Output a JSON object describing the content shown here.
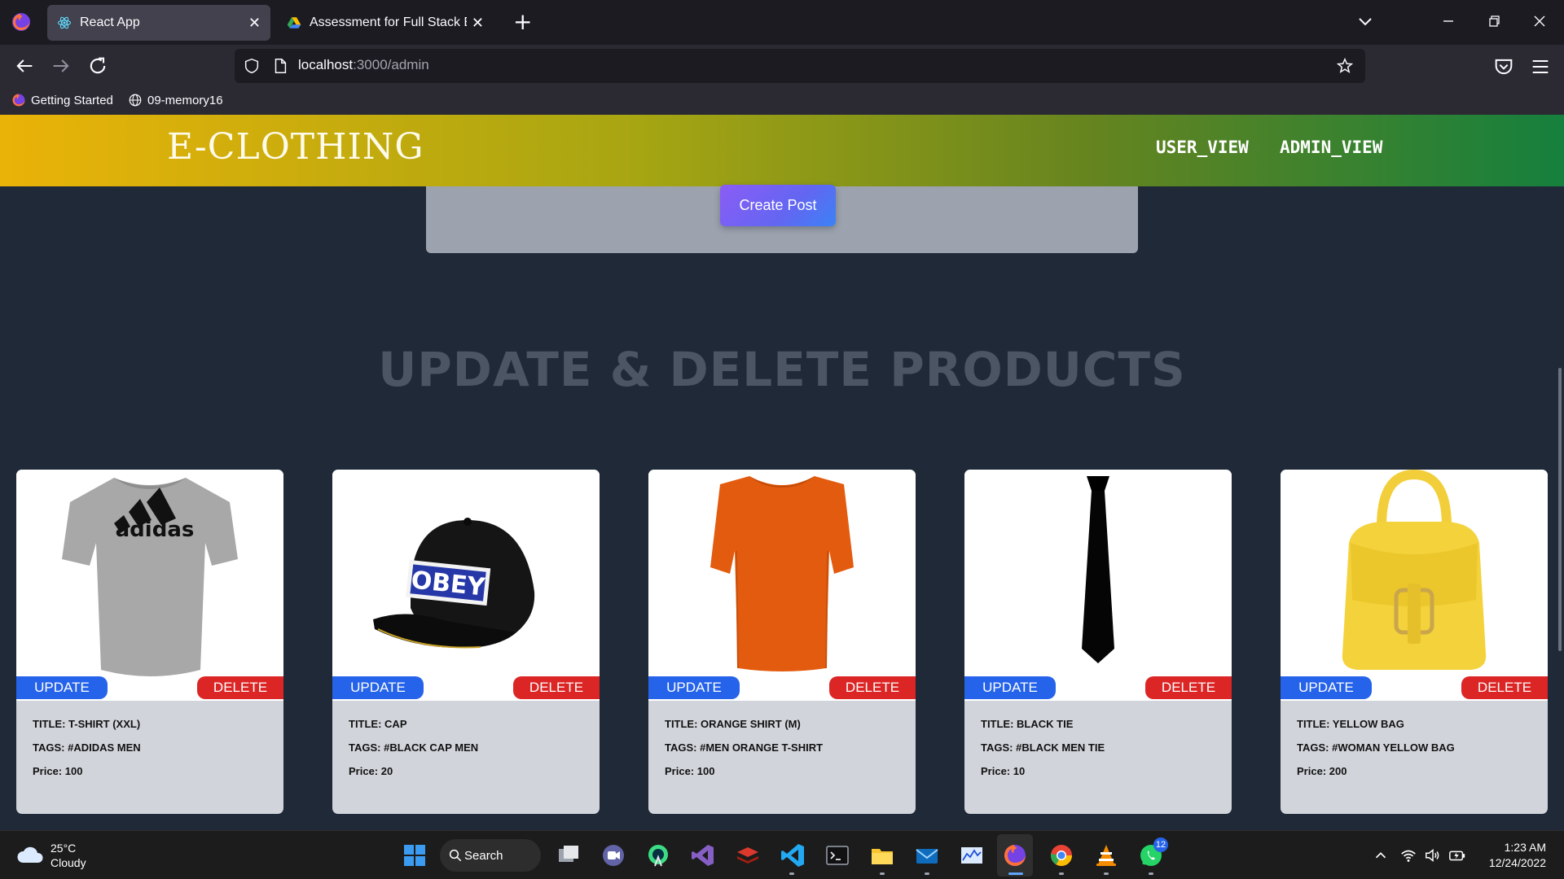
{
  "browser": {
    "tabs": [
      {
        "title": "React App",
        "active": true
      },
      {
        "title": "Assessment for Full Stack Engin",
        "active": false
      }
    ],
    "url_host": "localhost",
    "url_rest": ":3000/admin",
    "bookmarks": [
      "Getting Started",
      "09-memory16"
    ]
  },
  "header": {
    "brand": "E-CLOTHING",
    "nav": [
      "USER_VIEW",
      "ADMIN_VIEW"
    ]
  },
  "form": {
    "create_label": "Create Post"
  },
  "section": {
    "title": "UPDATE & DELETE PRODUCTS"
  },
  "card_actions": {
    "update": "UPDATE",
    "delete": "DELETE"
  },
  "products": [
    {
      "title": "TITLE: T-SHIRT (XXL)",
      "tags": "TAGS: #ADIDAS MEN",
      "price": "Price: 100",
      "image": "grey-adidas-tshirt",
      "logo_text": "adidas"
    },
    {
      "title": "TITLE: CAP",
      "tags": "TAGS: #BLACK CAP MEN",
      "price": "Price: 20",
      "image": "black-obey-cap",
      "logo_text": "OBEY"
    },
    {
      "title": "TITLE: ORANGE SHIRT (M)",
      "tags": "TAGS: #MEN ORANGE T-SHIRT",
      "price": "Price: 100",
      "image": "orange-tshirt"
    },
    {
      "title": "TITLE: BLACK TIE",
      "tags": "TAGS: #BLACK MEN TIE",
      "price": "Price: 10",
      "image": "black-tie"
    },
    {
      "title": "TITLE: YELLOW BAG",
      "tags": "TAGS: #WOMAN YELLOW BAG",
      "price": "Price: 200",
      "image": "yellow-handbag"
    }
  ],
  "taskbar": {
    "weather_temp": "25°C",
    "weather_desc": "Cloudy",
    "search_label": "Search",
    "time": "1:23 AM",
    "date": "12/24/2022",
    "whatsapp_badge": "12"
  },
  "colors": {
    "update": "#2563eb",
    "delete": "#dc2626",
    "header_start": "#eab308",
    "header_end": "#15803d"
  }
}
